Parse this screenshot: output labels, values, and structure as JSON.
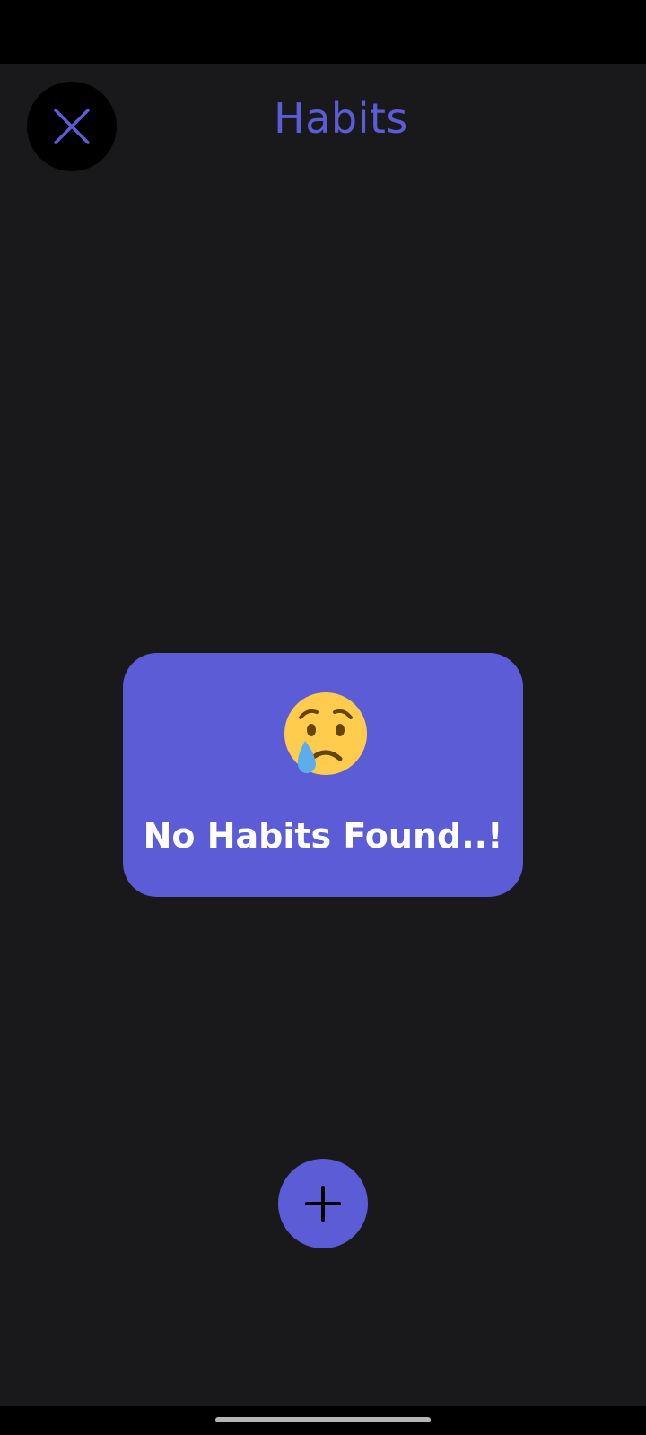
{
  "header": {
    "title": "Habits",
    "close_icon": "close-icon"
  },
  "empty_state": {
    "icon": "crying-face-emoji",
    "message": "No Habits Found..!"
  },
  "fab": {
    "icon": "plus-icon"
  },
  "colors": {
    "background": "#19191b",
    "accent": "#5b5cd6",
    "text_light": "#ffffff",
    "bar": "#000000"
  }
}
